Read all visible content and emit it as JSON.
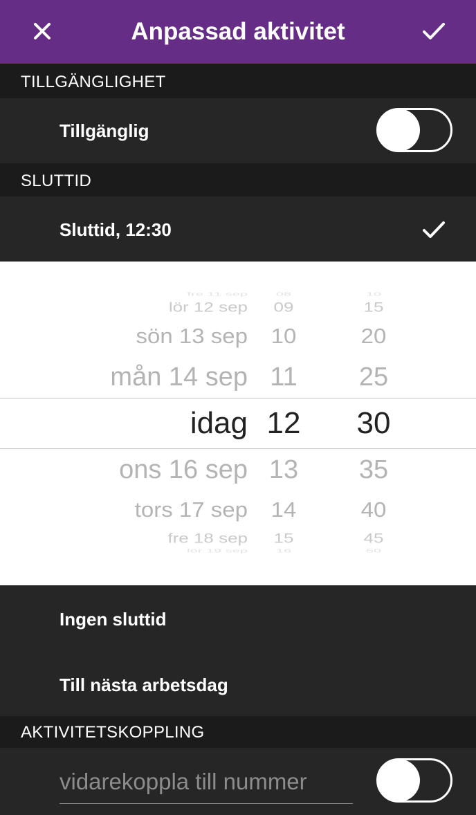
{
  "header": {
    "title": "Anpassad aktivitet",
    "close_icon": "close-icon",
    "confirm_icon": "checkmark-icon",
    "background": "#652d86"
  },
  "availability": {
    "section_title": "TILLGÄNGLIGHET",
    "toggle_label": "Tillgänglig",
    "toggle_on": false
  },
  "end_time": {
    "section_title": "SLUTTID",
    "row_label": "Sluttid,  12:30",
    "row_checked_icon": "checkmark-icon"
  },
  "picker": {
    "days": [
      "fre 11 sep",
      "lör 12 sep",
      "sön 13 sep",
      "mån 14 sep",
      "idag",
      "ons 16 sep",
      "tors 17 sep",
      "fre 18 sep",
      "lör 19 sep"
    ],
    "hours": [
      "08",
      "09",
      "10",
      "11",
      "12",
      "13",
      "14",
      "15",
      "16"
    ],
    "minutes": [
      "10",
      "15",
      "20",
      "25",
      "30",
      "35",
      "40",
      "45",
      "50"
    ],
    "selected": {
      "day": "idag",
      "hour": "12",
      "minute": "30"
    }
  },
  "options": {
    "no_end_time": "Ingen sluttid",
    "next_workday": "Till nästa arbetsdag"
  },
  "forwarding": {
    "section_title": "AKTIVITETSKOPPLING",
    "input_value": "",
    "input_placeholder": "vidarekoppla till nummer",
    "toggle_on": false
  }
}
